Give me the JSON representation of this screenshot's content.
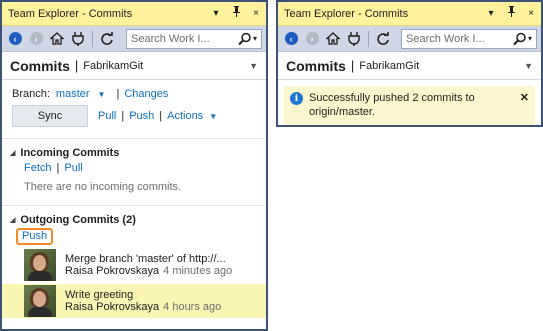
{
  "left": {
    "title": "Team Explorer - Commits",
    "search_placeholder": "Search Work I...",
    "header": {
      "title": "Commits",
      "repo": "FabrikamGit"
    },
    "branch": {
      "label": "Branch:",
      "value": "master",
      "changes": "Changes"
    },
    "actions": {
      "sync": "Sync",
      "pull": "Pull",
      "push": "Push",
      "actions": "Actions"
    },
    "incoming": {
      "title": "Incoming Commits",
      "fetch": "Fetch",
      "pull": "Pull",
      "empty": "There are no incoming commits."
    },
    "outgoing": {
      "title": "Outgoing Commits (2)",
      "push": "Push",
      "commits": [
        {
          "message": "Merge branch 'master' of http://...",
          "author": "Raisa Pokrovskaya",
          "time": "4 minutes ago"
        },
        {
          "message": "Write greeting",
          "author": "Raisa Pokrovskaya",
          "time": "4 hours ago"
        }
      ]
    }
  },
  "right": {
    "title": "Team Explorer - Commits",
    "search_placeholder": "Search Work I...",
    "header": {
      "title": "Commits",
      "repo": "FabrikamGit"
    },
    "notification": "Successfully pushed 2 commits to origin/master."
  },
  "titlebar_buttons": {
    "dropdown": "▾",
    "pin": "⊥",
    "close": "×"
  },
  "icons": {
    "back": "back-arrow-icon",
    "forward": "forward-arrow-icon",
    "home": "home-icon",
    "connect": "plug-icon",
    "refresh": "refresh-icon",
    "search": "search-icon",
    "info": "info-icon"
  },
  "colors": {
    "titlebar": "#fff29d",
    "link": "#0e70c0",
    "selected": "#fbf5b3",
    "frame": "#3d5277",
    "highlight": "#f08a24"
  }
}
